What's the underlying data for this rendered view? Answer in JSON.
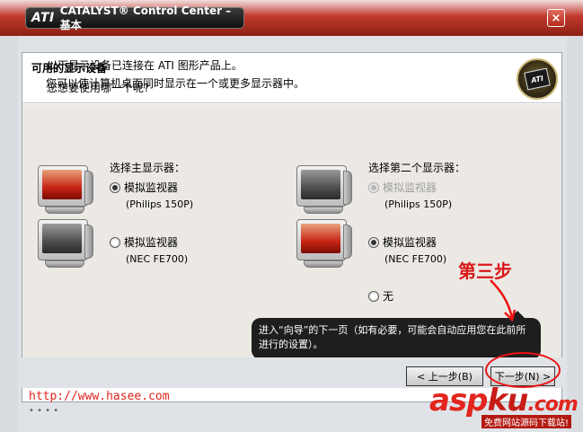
{
  "window": {
    "title": "CATALYST® Control Center – 基本",
    "logo_text": "ATI",
    "close_label": "×"
  },
  "header": {
    "title": "可用的显示设备",
    "subtitle": "您可以使计算机桌面同时显示在一个或更多显示器中。",
    "badge_text": "ATI"
  },
  "intro": {
    "line1": "以下显示设备已连接在 ATI 图形产品上。",
    "line2": "您想要使用哪一个呢?"
  },
  "primary": {
    "label": "选择主显示器：",
    "options": [
      {
        "label": "模拟监视器",
        "model": "(Philips 150P)",
        "checked": true,
        "disabled": false
      },
      {
        "label": "模拟监视器",
        "model": "(NEC FE700)",
        "checked": false,
        "disabled": false
      }
    ]
  },
  "secondary": {
    "label": "选择第二个显示器：",
    "options": [
      {
        "label": "模拟监视器",
        "model": "(Philips 150P)",
        "checked": false,
        "disabled": true
      },
      {
        "label": "模拟监视器",
        "model": "(NEC FE700)",
        "checked": true,
        "disabled": false
      },
      {
        "label": "无",
        "checked": false,
        "disabled": false
      }
    ]
  },
  "tooltip": {
    "text": "进入“向导”的下一页（如有必要，可能会自动应用您在此前所进行的设置）。"
  },
  "buttons": {
    "back": "< 上一步(B)",
    "next": "下一步(N) >"
  },
  "annotation": {
    "text": "第三步"
  },
  "watermark": {
    "url": "http://www.hasee.com",
    "dots": "• • • •",
    "brand_a": "asp",
    "brand_b": "ku",
    "brand_c": ".com",
    "brand_sub": "免费网站源码下载站!"
  },
  "colors": {
    "title_red": "#c13a2c",
    "annotation_red": "#d91818",
    "tooltip_bg": "#1e1e1e"
  }
}
